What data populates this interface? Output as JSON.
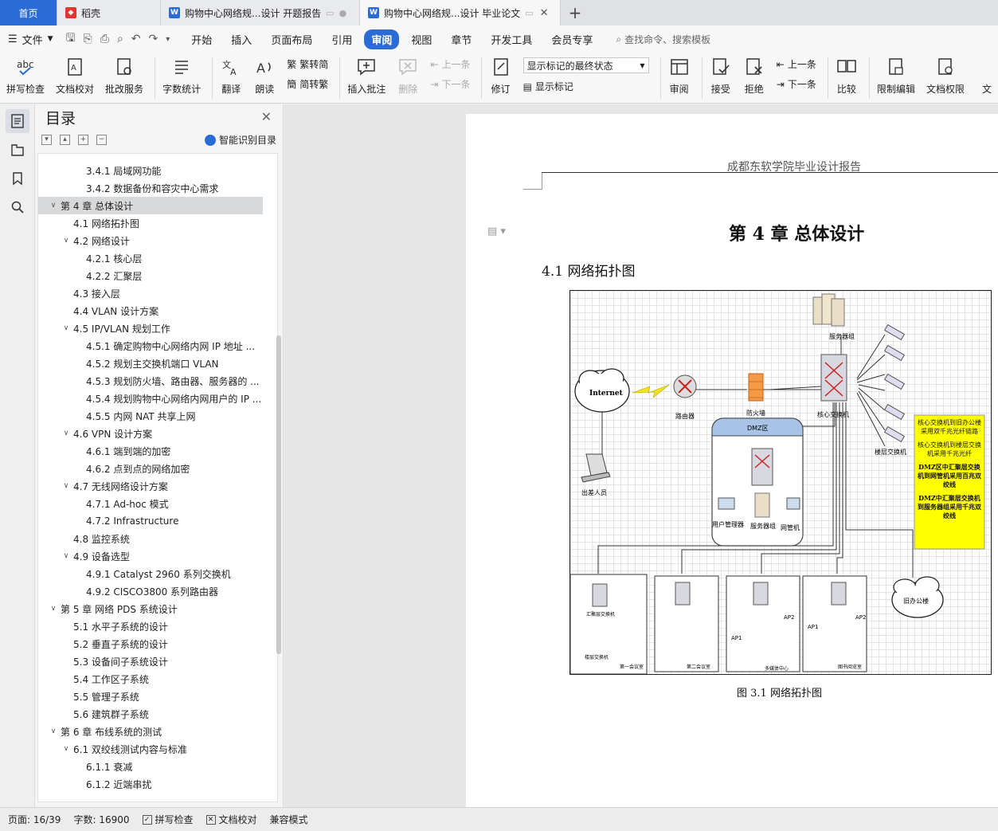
{
  "tabs": [
    {
      "label": "首页",
      "kind": "home"
    },
    {
      "label": "稻壳",
      "kind": "docer",
      "icon_color": "#e8322f"
    },
    {
      "label": "购物中心网络规...设计 开题报告",
      "kind": "doc",
      "icon_color": "#2b6cd4"
    },
    {
      "label": "购物中心网络规...设计 毕业论文",
      "kind": "doc",
      "icon_color": "#2b6cd4",
      "active": true
    }
  ],
  "menu": {
    "file_label": "文件",
    "items": [
      "开始",
      "插入",
      "页面布局",
      "引用",
      "审阅",
      "视图",
      "章节",
      "开发工具",
      "会员专享"
    ],
    "active": "审阅",
    "search_label": "查找命令、搜索模板"
  },
  "ribbon": {
    "spell_check": "拼写检查",
    "doc_proof": "文档校对",
    "batch_service": "批改服务",
    "word_count": "字数统计",
    "translate": "翻译",
    "read_aloud": "朗读",
    "trad_convert": "繁转简",
    "simp_convert": "简转繁",
    "insert_comment": "插入批注",
    "delete": "删除",
    "prev_comment": "上一条",
    "next_comment": "下一条",
    "revise": "修订",
    "markup_combo": "显示标记的最终状态",
    "show_markup": "显示标记",
    "review": "审阅",
    "accept": "接受",
    "reject": "拒绝",
    "prev_change": "上一条",
    "next_change": "下一条",
    "compare": "比较",
    "restrict_edit": "限制编辑",
    "doc_permission": "文档权限",
    "cut_off": "文"
  },
  "toc": {
    "title": "目录",
    "smart_label": "智能识别目录",
    "items": [
      {
        "text": "3.4.1  局域网功能",
        "level": 3
      },
      {
        "text": "3.4.2  数据备份和容灾中心需求",
        "level": 3
      },
      {
        "text": "第 4 章  总体设计",
        "level": 1,
        "arrow": "open",
        "selected": true
      },
      {
        "text": "4.1  网络拓扑图",
        "level": 2
      },
      {
        "text": "4.2  网络设计",
        "level": 2,
        "arrow": "open"
      },
      {
        "text": "4.2.1  核心层",
        "level": 3
      },
      {
        "text": "4.2.2  汇聚层",
        "level": 3
      },
      {
        "text": "4.3  接入层",
        "level": 2
      },
      {
        "text": "4.4 VLAN 设计方案",
        "level": 2
      },
      {
        "text": "4.5 IP/VLAN  规划工作",
        "level": 2,
        "arrow": "open"
      },
      {
        "text": "4.5.1  确定购物中心网络内网 IP 地址 ...",
        "level": 3
      },
      {
        "text": "4.5.2  规划主交换机端口 VLAN",
        "level": 3
      },
      {
        "text": "4.5.3  规划防火墙、路由器、服务器的 ...",
        "level": 3
      },
      {
        "text": "4.5.4  规划购物中心网络内网用户的 IP ...",
        "level": 3
      },
      {
        "text": "4.5.5  内网 NAT 共享上网",
        "level": 3
      },
      {
        "text": "4.6 VPN  设计方案",
        "level": 2,
        "arrow": "open"
      },
      {
        "text": "4.6.1  端到端的加密",
        "level": 3
      },
      {
        "text": "4.6.2  点到点的网络加密",
        "level": 3
      },
      {
        "text": "4.7  无线网络设计方案",
        "level": 2,
        "arrow": "open"
      },
      {
        "text": "4.7.1 Ad-hoc  模式",
        "level": 3
      },
      {
        "text": "4.7.2 Infrastructure",
        "level": 3
      },
      {
        "text": "4.8  监控系统",
        "level": 2
      },
      {
        "text": "4.9  设备选型",
        "level": 2,
        "arrow": "open"
      },
      {
        "text": "4.9.1 Catalyst 2960  系列交换机",
        "level": 3
      },
      {
        "text": "4.9.2 CISCO3800  系列路由器",
        "level": 3
      },
      {
        "text": "第 5 章  网络 PDS 系统设计",
        "level": 1,
        "arrow": "open"
      },
      {
        "text": "5.1  水平子系统的设计",
        "level": 2
      },
      {
        "text": "5.2  垂直子系统的设计",
        "level": 2
      },
      {
        "text": "5.3  设备间子系统设计",
        "level": 2
      },
      {
        "text": "5.4  工作区子系统",
        "level": 2
      },
      {
        "text": "5.5  管理子系统",
        "level": 2
      },
      {
        "text": "5.6  建筑群子系统",
        "level": 2
      },
      {
        "text": "第 6 章  布线系统的测试",
        "level": 1,
        "arrow": "open"
      },
      {
        "text": "6.1  双绞线测试内容与标准",
        "level": 2,
        "arrow": "open"
      },
      {
        "text": "6.1.1  衰减",
        "level": 3
      },
      {
        "text": "6.1.2  近端串扰",
        "level": 3
      }
    ]
  },
  "document": {
    "header": "成都东软学院毕业设计报告",
    "chapter_title": "第 4 章  总体设计",
    "section_title": "4.1  网络拓扑图",
    "caption": "图 3.1  网络拓扑图"
  },
  "diagram": {
    "internet": "Internet",
    "router": "路由器",
    "firewall": "防火墙",
    "core_switch": "核心交换机",
    "server_group_top": "服务器组",
    "floor_switch": "楼层交换机",
    "dmz": "DMZ区",
    "user_mgr": "用户管理器",
    "server_group": "服务器组",
    "netmgr": "网管机",
    "traveler": "出差人员",
    "old_office": "旧办公楼",
    "agg_switch": "汇聚层交换机",
    "ap1": "AP1",
    "ap2": "AP2",
    "meeting1": "第一会议室",
    "meeting2": "第二会议室",
    "multimedia": "多媒体中心",
    "library": "图书阅览室",
    "note1": "核心交换机到旧办公楼采用双千兆光纤链路",
    "note2": "核心交换机到楼层交换机采用千兆光纤",
    "note3": "DMZ区中汇聚层交换机到网管机采用百兆双绞线",
    "note4": "DMZ中汇聚层交换机到服务器组采用千兆双绞线"
  },
  "status": {
    "page": "页面: 16/39",
    "words": "字数: 16900",
    "spell": "拼写检查",
    "proof": "文档校对",
    "compat": "兼容模式"
  }
}
